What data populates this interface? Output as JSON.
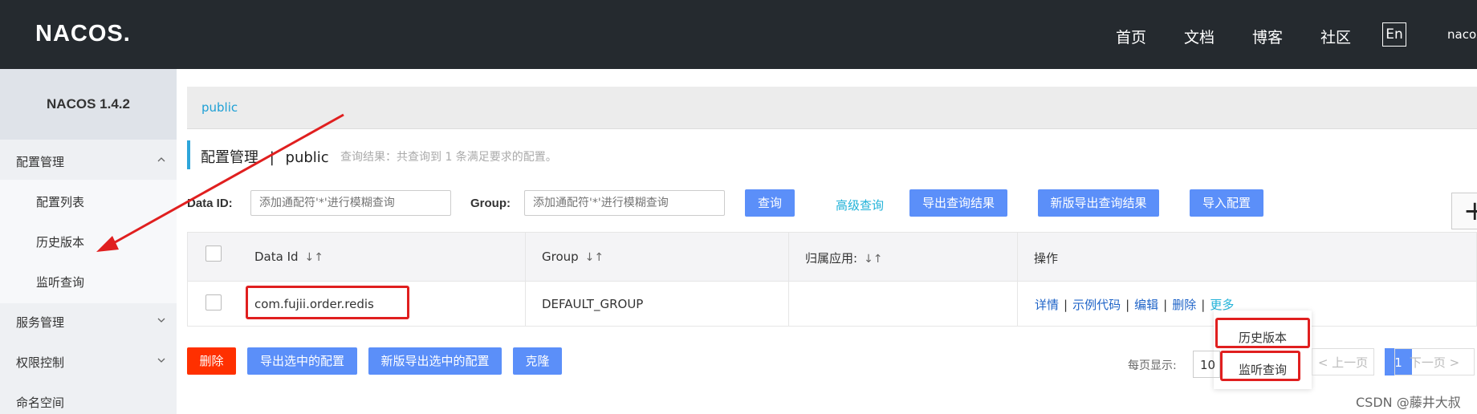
{
  "header": {
    "logo": "NACOS.",
    "nav": [
      "首页",
      "文档",
      "博客",
      "社区"
    ],
    "lang": "En",
    "user": "nacos"
  },
  "sidebar": {
    "version": "NACOS 1.4.2",
    "groups": [
      {
        "label": "配置管理",
        "items": [
          "配置列表",
          "历史版本",
          "监听查询"
        ]
      },
      {
        "label": "服务管理"
      },
      {
        "label": "权限控制"
      },
      {
        "label": "命名空间"
      }
    ]
  },
  "breadcrumb": "public",
  "page": {
    "title": "配置管理",
    "divider": "|",
    "namespace": "public",
    "result_info": "查询结果：共查询到 1 条满足要求的配置。"
  },
  "search": {
    "data_id_label": "Data ID:",
    "group_label": "Group:",
    "placeholder": "添加通配符'*'进行模糊查询",
    "query_btn": "查询",
    "advanced": "高级查询",
    "export": "导出查询结果",
    "export_new": "新版导出查询结果",
    "import": "导入配置"
  },
  "table": {
    "headers": [
      "Data Id",
      "Group",
      "归属应用:",
      "操作"
    ],
    "sort_glyph": "↓↑",
    "rows": [
      {
        "data_id": "com.fujii.order.redis",
        "group": "DEFAULT_GROUP",
        "app": ""
      }
    ],
    "ops": [
      "详情",
      "示例代码",
      "编辑",
      "删除"
    ],
    "ops_sep": "|",
    "more": "更多"
  },
  "dropdown": [
    "历史版本",
    "监听查询"
  ],
  "bottom": {
    "delete": "删除",
    "export_selected": "导出选中的配置",
    "export_selected_new": "新版导出选中的配置",
    "clone": "克隆"
  },
  "pagination": {
    "label": "每页显示:",
    "size": "10",
    "prev": "< 上一页",
    "current": "1",
    "next": "下一页 >"
  },
  "watermark": "CSDN @藤井大叔",
  "colors": {
    "primary": "#5b8ff9",
    "danger": "#ff3000",
    "header_bg": "#252a2f",
    "annotation": "#e01f1f"
  }
}
